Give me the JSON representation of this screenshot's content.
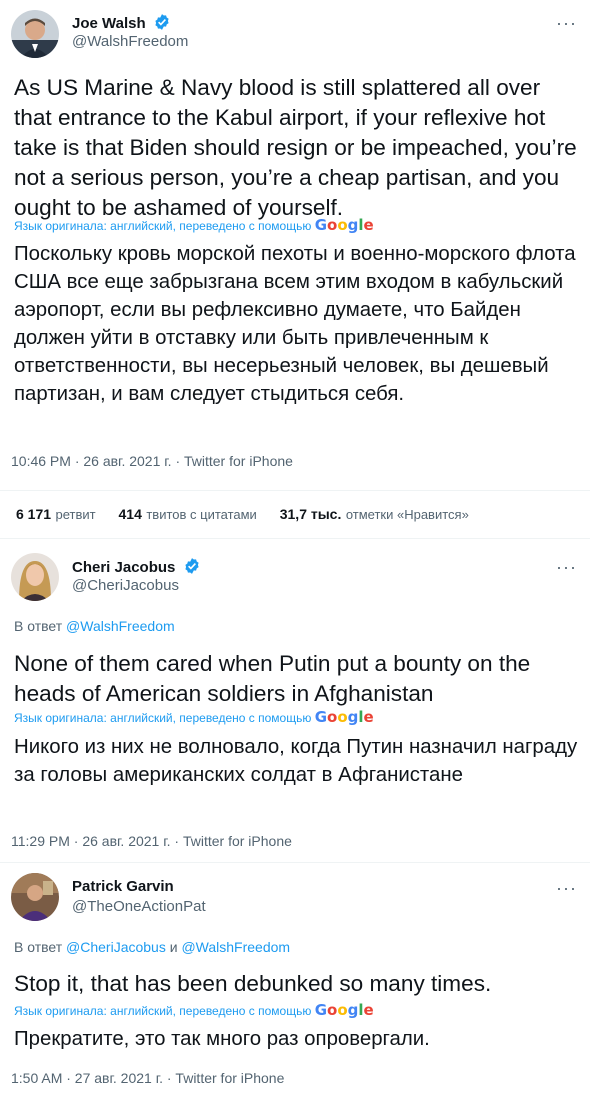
{
  "tweet_main": {
    "author_name": "Joe Walsh",
    "author_handle": "@WalshFreedom",
    "text": "As US Marine & Navy blood is still splattered all over that entrance to the Kabul airport, if your reflexive hot take is that Biden should resign or be impeached, you’re not a serious person, you’re a cheap partisan, and you ought to be ashamed of yourself.",
    "translation_note": "Язык оригинала: английский, переведено с помощью",
    "translation_provider": "Google",
    "translated_text": "Поскольку кровь морской пехоты и военно-морского флота США все еще забрызгана всем этим входом в кабульский аэропорт, если вы рефлексивно думаете, что Байден должен уйти в отставку или быть привлеченным к ответственности, вы несерьезный человек, вы дешевый партизан, и вам следует стыдиться себя.",
    "timestamp": "10:46 PM · 26 авг. 2021 г. · Twitter for iPhone",
    "stats": {
      "retweets_count": "6 171",
      "retweets_label": "ретвит",
      "quotes_count": "414",
      "quotes_label": "твитов с цитатами",
      "likes_count": "31,7 тыс.",
      "likes_label": "отметки «Нравится»"
    }
  },
  "reply_1": {
    "author_name": "Cheri Jacobus",
    "author_handle": "@CheriJacobus",
    "reply_prefix": "В ответ",
    "reply_to": "@WalshFreedom",
    "text": "None of them cared when Putin put a bounty on the heads of American soldiers in Afghanistan",
    "translation_note": "Язык оригинала: английский, переведено с помощью",
    "translation_provider": "Google",
    "translated_text": "Никого из них не волновало, когда Путин назначил награду за головы американских солдат в Афганистане",
    "timestamp": "11:29 PM · 26 авг. 2021 г. · Twitter for iPhone"
  },
  "reply_2": {
    "author_name": "Patrick Garvin",
    "author_handle": "@TheOneActionPat",
    "reply_prefix": "В ответ",
    "reply_to_1": "@CheriJacobus",
    "reply_and": "и",
    "reply_to_2": "@WalshFreedom",
    "text": "Stop it, that has been debunked so many times.",
    "translation_note": "Язык оригинала: английский, переведено с помощью",
    "translation_provider": "Google",
    "translated_text": "Прекратите, это так много раз опровергали.",
    "timestamp": "1:50 AM · 27 авг. 2021 г. · Twitter for iPhone"
  },
  "more_glyph": "···",
  "colors": {
    "accent": "#1d9bf0",
    "text": "#0f1419",
    "muted": "#536471",
    "divider": "#eff3f4"
  }
}
